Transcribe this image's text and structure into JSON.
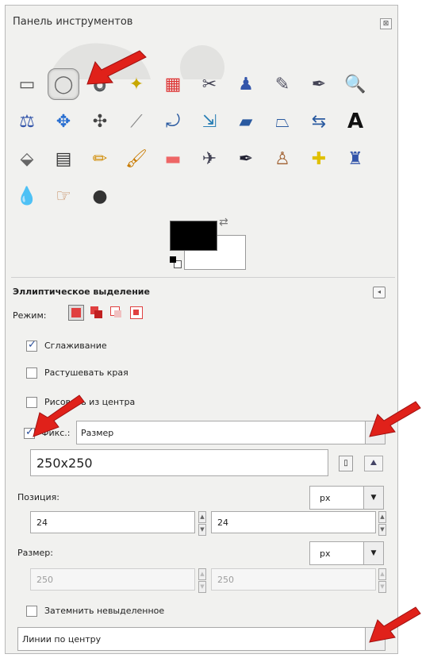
{
  "panel": {
    "title": "Панель инструментов",
    "close_glyph": "⊠"
  },
  "tools": [
    {
      "icon": "rect-select-icon",
      "glyph": "▭",
      "color": "#555"
    },
    {
      "icon": "ellipse-select-icon",
      "glyph": "◯",
      "color": "#666",
      "active": true
    },
    {
      "icon": "free-select-icon",
      "glyph": "➰",
      "color": "#777"
    },
    {
      "icon": "fuzzy-select-icon",
      "glyph": "✦",
      "color": "#c8a800"
    },
    {
      "icon": "select-by-color-icon",
      "glyph": "▦",
      "color": "#d33"
    },
    {
      "icon": "scissors-icon",
      "glyph": "✂",
      "color": "#445"
    },
    {
      "icon": "foreground-select-icon",
      "glyph": "♟",
      "color": "#3355aa"
    },
    {
      "icon": "paths-icon",
      "glyph": "✎",
      "color": "#556"
    },
    {
      "icon": "color-picker-icon",
      "glyph": "✒",
      "color": "#445"
    },
    {
      "icon": "zoom-icon",
      "glyph": "🔍",
      "color": "#4b7bbf"
    },
    {
      "icon": "measure-icon",
      "glyph": "⚖",
      "color": "#3355aa"
    },
    {
      "icon": "move-icon",
      "glyph": "✥",
      "color": "#2a6fd1"
    },
    {
      "icon": "align-icon",
      "glyph": "✣",
      "color": "#444"
    },
    {
      "icon": "crop-icon",
      "glyph": "⟋",
      "color": "#888"
    },
    {
      "icon": "rotate-icon",
      "glyph": "⤾",
      "color": "#2a5aa0"
    },
    {
      "icon": "scale-icon",
      "glyph": "⇲",
      "color": "#2a7fb5"
    },
    {
      "icon": "shear-icon",
      "glyph": "▰",
      "color": "#2a5aa0"
    },
    {
      "icon": "perspective-icon",
      "glyph": "⏢",
      "color": "#2a5aa0"
    },
    {
      "icon": "flip-icon",
      "glyph": "⇆",
      "color": "#2a5aa0"
    },
    {
      "icon": "text-icon",
      "glyph": "A",
      "color": "#111"
    },
    {
      "icon": "bucket-fill-icon",
      "glyph": "⬙",
      "color": "#666"
    },
    {
      "icon": "blend-icon",
      "glyph": "▤",
      "color": "#333"
    },
    {
      "icon": "pencil-icon",
      "glyph": "✏",
      "color": "#d08a00"
    },
    {
      "icon": "paintbrush-icon",
      "glyph": "🖌",
      "color": "#c87a00"
    },
    {
      "icon": "eraser-icon",
      "glyph": "▬",
      "color": "#e66"
    },
    {
      "icon": "airbrush-icon",
      "glyph": "✈",
      "color": "#445"
    },
    {
      "icon": "ink-icon",
      "glyph": "✒",
      "color": "#223"
    },
    {
      "icon": "clone-icon",
      "glyph": "♙",
      "color": "#a06030"
    },
    {
      "icon": "heal-icon",
      "glyph": "✚",
      "color": "#e0c000"
    },
    {
      "icon": "perspective-clone-icon",
      "glyph": "♜",
      "color": "#3355aa"
    },
    {
      "icon": "blur-icon",
      "glyph": "💧",
      "color": "#2a6fd1"
    },
    {
      "icon": "smudge-icon",
      "glyph": "☞",
      "color": "#c08050"
    },
    {
      "icon": "dodge-burn-icon",
      "glyph": "●",
      "color": "#333"
    }
  ],
  "options": {
    "title": "Эллиптическое выделение",
    "collapse_glyph": "◂",
    "mode_label": "Режим:",
    "antialias_label": "Сглаживание",
    "antialias_checked": true,
    "feather_label": "Растушевать края",
    "feather_checked": false,
    "from_center_label": "Рисовать из центра",
    "from_center_checked": false,
    "fixed_label": "Фикс.:",
    "fixed_checked": true,
    "fixed_value": "Размер",
    "fixed_size_value": "250x250",
    "position_label": "Позиция:",
    "position_unit": "px",
    "position_x": "24",
    "position_y": "24",
    "size_label": "Размер:",
    "size_unit": "px",
    "size_w": "250",
    "size_h": "250",
    "highlight_label": "Затемнить невыделенное",
    "highlight_checked": false,
    "guides_value": "Линии по центру"
  },
  "colors": {
    "arrow": "#e0211a",
    "mode_red": "#e04040"
  }
}
